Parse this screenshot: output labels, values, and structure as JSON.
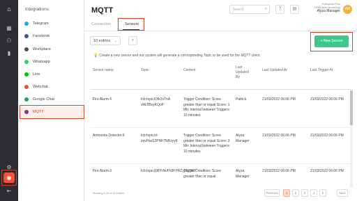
{
  "nav": {
    "title": "Integrations",
    "items": [
      {
        "label": "Telegram",
        "color": "#2aa3df"
      },
      {
        "label": "Facebook",
        "color": "#3b5998"
      },
      {
        "label": "Workplace",
        "color": "#4b4f56"
      },
      {
        "label": "Whatsapp",
        "color": "#25d366"
      },
      {
        "label": "Line",
        "color": "#00c300"
      },
      {
        "label": "Webchat",
        "color": "#e0533b"
      },
      {
        "label": "Google Chat",
        "color": "#1ea362"
      },
      {
        "label": "MQTT",
        "color": "#7a3b8f"
      }
    ]
  },
  "header": {
    "title": "MQTT",
    "search_placeholder": "Search",
    "plan_line1": "Enterprise Plan",
    "plan_line2": "(9999 days remaining)",
    "user_name": "Alyza Manager",
    "avatar_initials": "AM"
  },
  "tabs": [
    {
      "label": "Connection"
    },
    {
      "label": "Sensors"
    }
  ],
  "controls": {
    "entries_label": "10 entries",
    "new_sensor_label": "+ New Sensor"
  },
  "info_text": "Create a new sensor and our system will generate a corresponding Topic to be used for the MQTT client.",
  "table": {
    "headers": [
      "Sensor name",
      "Topic",
      "Content",
      "Last Updated By",
      "Last Updated At",
      "Last Trigger At"
    ],
    "rows": [
      {
        "name": "Fire Alarm 4",
        "topic": "fcb:topic/Dfir2xTnA vhE5BsyKQoF",
        "content": "Trigger Condition: Score greater than or equal Score: 1 Min Interval between Triggers: 10 minutes",
        "updated_by": "Patrick",
        "updated_at": "21/03/2022 06:06 PM",
        "trigger_at": "21/03/2022 06:06 PM"
      },
      {
        "name": "Ammonia Detector 9",
        "topic": "fcb:topic/d-xqvFkeS2PNF7NRzyy8",
        "content": "Trigger Condition: Score greater than or equal Score: 3 Min Interval between Triggers: 10 minutes",
        "updated_by": "Alyza Manager",
        "updated_at": "21/03/2022 06:06 PM",
        "trigger_at": "21/03/2022 06:06 PM"
      },
      {
        "name": "Fire Alarm 3",
        "topic": "fcb:topic/j98YrNvFh9FPRZyjSLDk3",
        "content": "Trigger Condition: Score greater than or equal",
        "updated_by": "Alyza Manager",
        "updated_at": "21/03/2022 06:06 PM",
        "trigger_at": "21/03/2022 06:06 PM"
      }
    ]
  },
  "footer": {
    "showing": "Showing 1-10 of 42 entries",
    "pages": [
      "Previous",
      "1",
      "2",
      "3",
      "4",
      "5",
      "Next"
    ]
  }
}
